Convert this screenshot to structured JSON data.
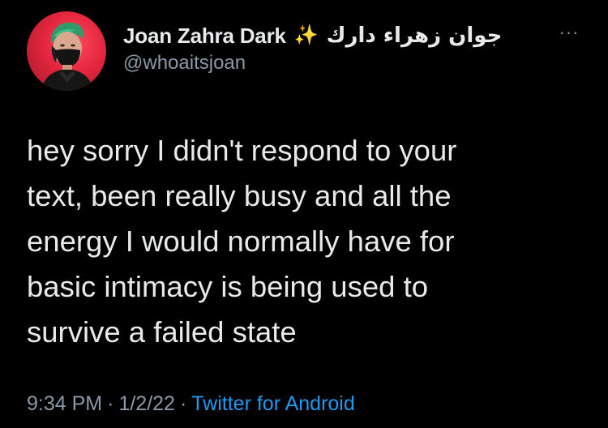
{
  "author": {
    "display_name": "Joan Zahra Dark",
    "emoji": "✨",
    "name_arabic": "جوان زهراء دارك",
    "handle": "@whoaitsjoan"
  },
  "more_label": "···",
  "tweet": {
    "text": "hey sorry I didn't respond to your\ntext, been really busy and all the\nenergy I would normally have for\nbasic intimacy is being used to\nsurvive a failed state",
    "time": "9:34 PM",
    "separator": "·",
    "date": "1/2/22",
    "source": "Twitter for Android"
  },
  "colors": {
    "background": "#000000",
    "text": "#e7e9ea",
    "secondary": "#8b98a5",
    "link": "#1d9bf0",
    "avatar_bg": "#e3263d"
  }
}
